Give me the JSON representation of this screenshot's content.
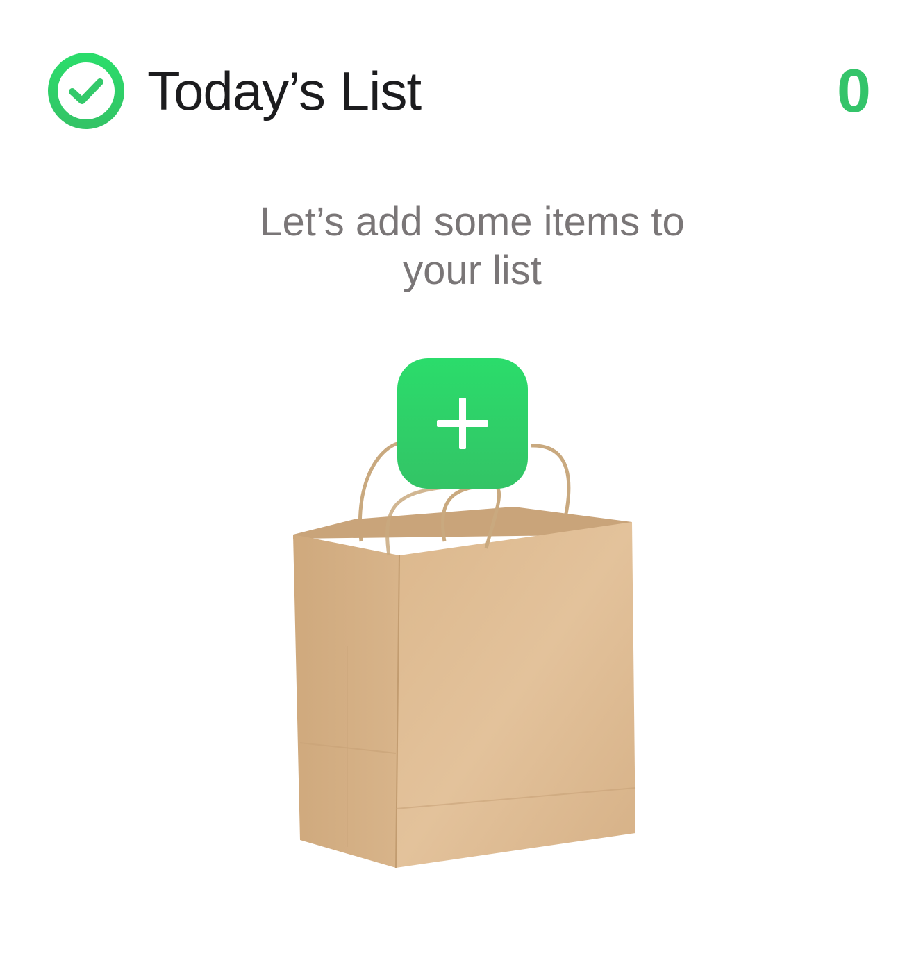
{
  "header": {
    "title": "Today’s List",
    "count": "0",
    "check_icon": "check-circle-icon"
  },
  "empty_state": {
    "line1": "Let’s add some items to",
    "line2": "your list",
    "illustration": "paper-shopping-bag"
  },
  "add_button": {
    "icon": "plus-icon"
  },
  "colors": {
    "accent": "#34c46a",
    "title_text": "#1c1c1e",
    "message_text": "#7a7677",
    "bag": "#d9b48a"
  }
}
